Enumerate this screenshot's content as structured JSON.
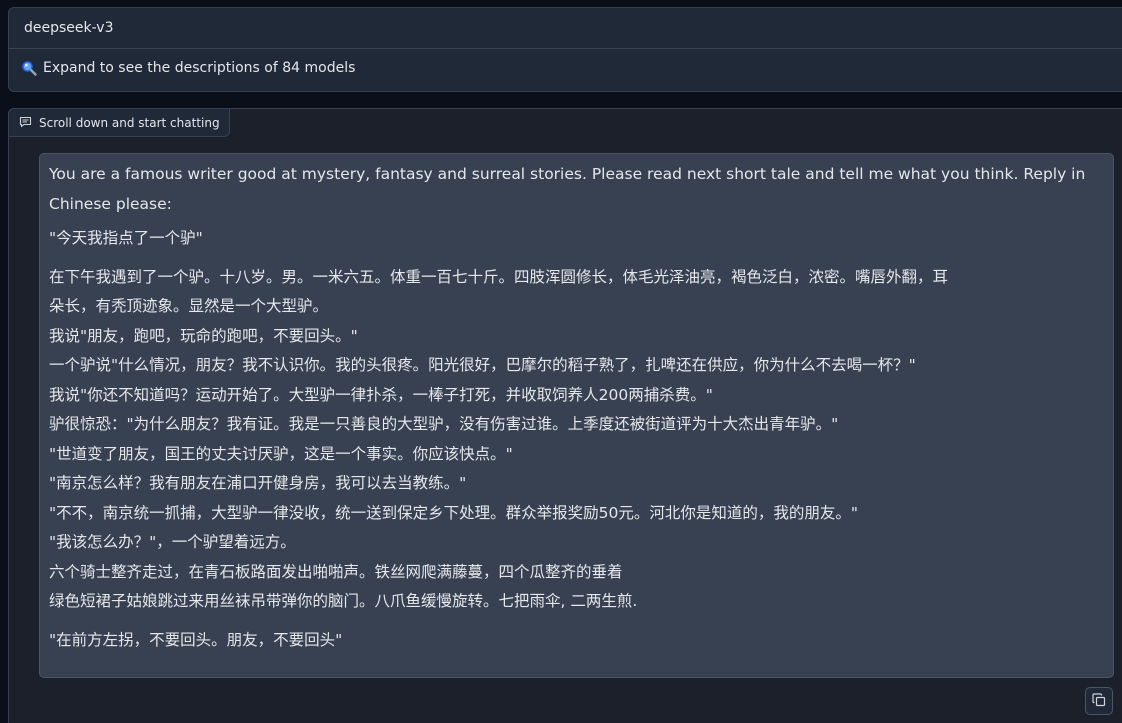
{
  "model_panel": {
    "model_name": "deepseek-v3",
    "expand_text": "Expand to see the descriptions of 84 models"
  },
  "chat": {
    "label": "Scroll down and start chatting",
    "message": {
      "intro": "You are a famous writer good at mystery, fantasy and surreal stories. Please read next short tale and tell me what you think. Reply in Chinese please:",
      "title": "\"今天我指点了一个驴\"",
      "body_lines": [
        "在下午我遇到了一个驴。十八岁。男。一米六五。体重一百七十斤。四肢浑圆修长，体毛光泽油亮，褐色泛白，浓密。嘴唇外翻，耳",
        "朵长，有秃顶迹象。显然是一个大型驴。",
        "我说\"朋友，跑吧，玩命的跑吧，不要回头。\"",
        "一个驴说\"什么情况，朋友？我不认识你。我的头很疼。阳光很好，巴摩尔的稻子熟了，扎啤还在供应，你为什么不去喝一杯？\"",
        "我说\"你还不知道吗？运动开始了。大型驴一律扑杀，一棒子打死，并收取饲养人200两捕杀费。\"",
        "驴很惊恐：\"为什么朋友？我有证。我是一只善良的大型驴，没有伤害过谁。上季度还被街道评为十大杰出青年驴。\"",
        "\"世道变了朋友，国王的丈夫讨厌驴，这是一个事实。你应该快点。\"",
        "\"南京怎么样？我有朋友在浦口开健身房，我可以去当教练。\"",
        "\"不不，南京统一抓捕，大型驴一律没收，统一送到保定乡下处理。群众举报奖励50元。河北你是知道的，我的朋友。\"",
        "\"我该怎么办？\"，一个驴望着远方。",
        "六个骑士整齐走过，在青石板路面发出啪啪声。铁丝网爬满藤蔓，四个瓜整齐的垂着",
        "绿色短裙子姑娘跳过来用丝袜吊带弹你的脑门。八爪鱼缓慢旋转。七把雨伞, 二两生煎."
      ],
      "closing": "\"在前方左拐，不要回头。朋友，不要回头\""
    }
  },
  "icons": {
    "expand": "magnifier-icon",
    "chat_label": "chat-bubble-icon",
    "copy": "copy-icon"
  },
  "colors": {
    "background": "#0b0f19",
    "panel": "#1f2937",
    "bubble": "#374151",
    "border": "#374151",
    "text": "#e5e7eb",
    "accent_blue": "#3b82f6"
  }
}
